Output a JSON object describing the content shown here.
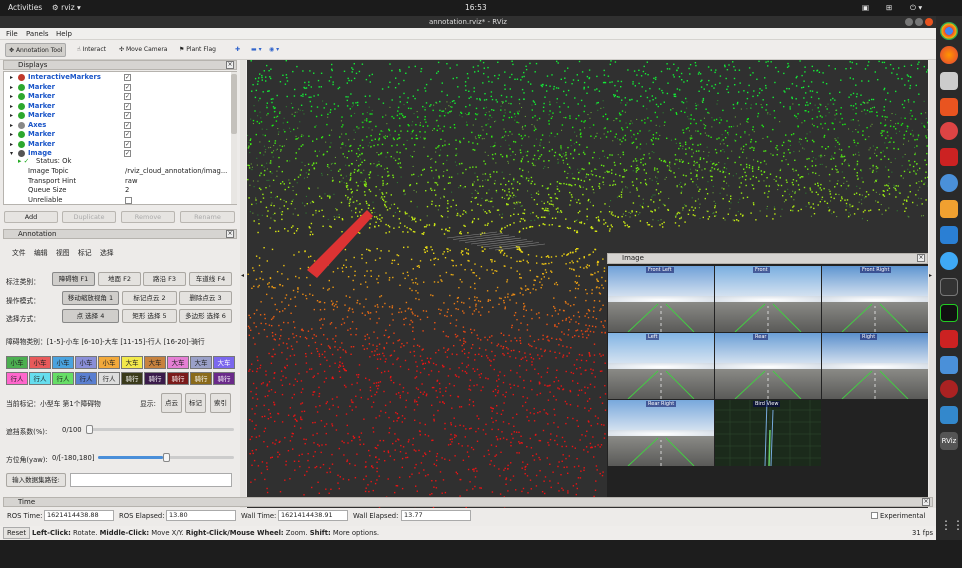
{
  "topbar": {
    "activities": "Activities",
    "app": "rviz",
    "clock": "16:53"
  },
  "window": {
    "title": "annotation.rviz* - RViz"
  },
  "menu": {
    "file": "File",
    "panels": "Panels",
    "help": "Help"
  },
  "toolbar": {
    "annotation_tool": "Annotation Tool",
    "interact": "Interact",
    "move_camera": "Move Camera",
    "plant_flag": "Plant Flag"
  },
  "displays": {
    "title": "Displays",
    "items": [
      {
        "label": "InteractiveMarkers",
        "checked": "✓"
      },
      {
        "label": "Marker",
        "checked": "✓"
      },
      {
        "label": "Marker",
        "checked": "✓"
      },
      {
        "label": "Marker",
        "checked": "✓"
      },
      {
        "label": "Marker",
        "checked": "✓"
      },
      {
        "label": "Axes",
        "checked": "✓"
      },
      {
        "label": "Marker",
        "checked": "✓"
      },
      {
        "label": "Marker",
        "checked": "✓"
      },
      {
        "label": "Image",
        "checked": "✓"
      }
    ],
    "status_ok": "Status: Ok",
    "props": [
      {
        "name": "Image Topic",
        "value": "/rviz_cloud_annotation/imag..."
      },
      {
        "name": "Transport Hint",
        "value": "raw"
      },
      {
        "name": "Queue Size",
        "value": "2"
      },
      {
        "name": "Unreliable",
        "value": ""
      }
    ],
    "buttons": {
      "add": "Add",
      "duplicate": "Duplicate",
      "remove": "Remove",
      "rename": "Rename"
    }
  },
  "annotation": {
    "title": "Annotation",
    "menu": [
      "文件",
      "编辑",
      "视图",
      "标记",
      "选择"
    ],
    "category_label": "标注类别：",
    "categories": [
      "障碍物 F1",
      "地面 F2",
      "路沿 F3",
      "车道线 F4"
    ],
    "mode_label": "操作模式：",
    "modes": [
      "移动缩放视角 1",
      "标记点云 2",
      "删除点云 3"
    ],
    "select_label": "选择方式：",
    "selects": [
      "点 选择 4",
      "矩形 选择 5",
      "多边形 选择 6"
    ],
    "obstacle_info": "障碍物类别：[1-5]-小车   [6-10]-大车   [11-15]-行人   [16-20]-骑行",
    "color_rows": [
      [
        {
          "t": "小车",
          "c": "#4caf50"
        },
        {
          "t": "小车",
          "c": "#e85a5a"
        },
        {
          "t": "小车",
          "c": "#4aa3df"
        },
        {
          "t": "小车",
          "c": "#8a8fd8"
        },
        {
          "t": "小车",
          "c": "#f2a93b"
        },
        {
          "t": "大车",
          "c": "#f2e94b"
        },
        {
          "t": "大车",
          "c": "#c7823e"
        },
        {
          "t": "大车",
          "c": "#e57fd4"
        },
        {
          "t": "大车",
          "c": "#9aa0c8"
        },
        {
          "t": "大车",
          "c": "#7b68ee"
        }
      ],
      [
        {
          "t": "行人",
          "c": "#ff66cc"
        },
        {
          "t": "行人",
          "c": "#66ddee"
        },
        {
          "t": "行人",
          "c": "#66dd66"
        },
        {
          "t": "行人",
          "c": "#5a7fd0"
        },
        {
          "t": "行人",
          "c": "#dddddd"
        },
        {
          "t": "骑行",
          "c": "#3a3a1a"
        },
        {
          "t": "骑行",
          "c": "#3a1a4a"
        },
        {
          "t": "骑行",
          "c": "#7a1a1a"
        },
        {
          "t": "骑行",
          "c": "#8a6a1a"
        },
        {
          "t": "骑行",
          "c": "#6a2a8a"
        }
      ]
    ],
    "current_label": "当前标记：小型车   第1个障碍物",
    "display_label": "显示:",
    "display_buttons": [
      "点云",
      "标记",
      "索引"
    ],
    "occlusion_label": "遮挡系数(%):",
    "occlusion_value": "0/100",
    "occlusion_level": 0,
    "yaw_label": "方位角(yaw):",
    "yaw_value": "0/[-180,180]",
    "yaw_level": 0.5,
    "dataset_button": "输入数据集路径:",
    "dataset_value": ""
  },
  "image_panel": {
    "title": "Image",
    "cam_labels": [
      "Front Left",
      "Front",
      "Front Right",
      "Left",
      "Rear",
      "Right",
      "Rear Right",
      "Bird View"
    ]
  },
  "time": {
    "title": "Time",
    "ros_time_label": "ROS Time:",
    "ros_time": "1621414438.88",
    "ros_elapsed_label": "ROS Elapsed:",
    "ros_elapsed": "13.80",
    "wall_time_label": "Wall Time:",
    "wall_time": "1621414438.91",
    "wall_elapsed_label": "Wall Elapsed:",
    "wall_elapsed": "13.77",
    "experimental": "Experimental"
  },
  "status": {
    "reset": "Reset",
    "hint_left": "Left-Click:",
    "hint_left_t": " Rotate. ",
    "hint_mid": "Middle-Click:",
    "hint_mid_t": " Move X/Y. ",
    "hint_right": "Right-Click/Mouse Wheel:",
    "hint_right_t": " Zoom. ",
    "hint_shift": "Shift:",
    "hint_shift_t": " More options.",
    "fps": "31 fps"
  },
  "colors": {
    "accent": "#1a55c8",
    "bg": "#303030"
  }
}
